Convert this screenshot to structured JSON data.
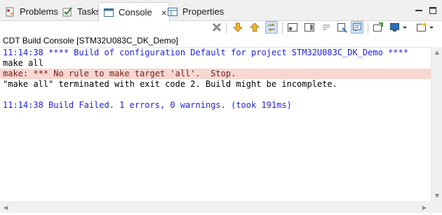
{
  "tabs": [
    {
      "label": "Problems",
      "icon": "problems-icon",
      "active": false
    },
    {
      "label": "Tasks",
      "icon": "tasks-icon",
      "active": false
    },
    {
      "label": "Console",
      "icon": "console-icon",
      "active": true
    },
    {
      "label": "Properties",
      "icon": "properties-icon",
      "active": false
    }
  ],
  "console": {
    "name": "CDT Build Console [STM32U083C_DK_Demo]",
    "lines": [
      {
        "text": "11:14:38 **** Build of configuration Default for project STM32U083C_DK_Demo ****",
        "style": "info"
      },
      {
        "text": "make all",
        "style": "normal"
      },
      {
        "text": "make: *** No rule to make target 'all'.  Stop.",
        "style": "error"
      },
      {
        "text": "\"make all\" terminated with exit code 2. Build might be incomplete.",
        "style": "normal"
      },
      {
        "text": "",
        "style": "normal"
      },
      {
        "text": "11:14:38 Build Failed. 1 errors, 0 warnings. (took 191ms)",
        "style": "info"
      }
    ]
  },
  "colors": {
    "info_text": "#1e1edc",
    "error_background": "#f7d7d2",
    "tab_bar": "#f0f0f0",
    "selected_tool": "#cfe3f7"
  }
}
